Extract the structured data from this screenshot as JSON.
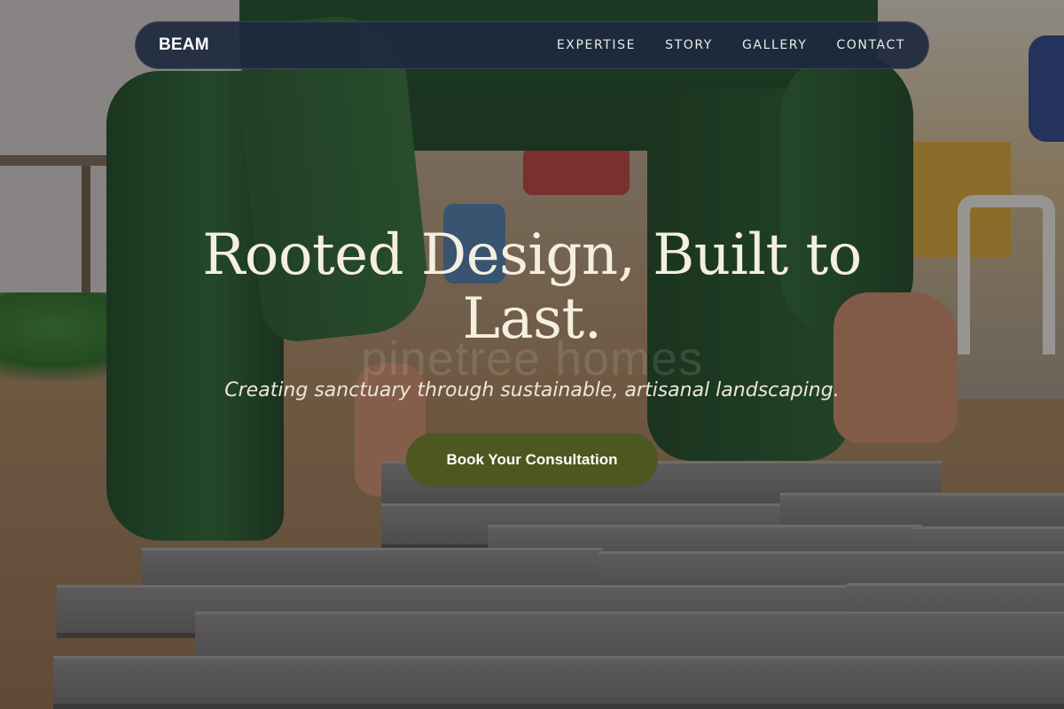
{
  "nav": {
    "brand": "BEAM",
    "links": [
      "EXPERTISE",
      "STORY",
      "GALLERY",
      "CONTACT"
    ]
  },
  "hero": {
    "headline": "Rooted Design, Built to Last.",
    "watermark": "pinetree homes",
    "subtitle": "Creating sanctuary through sustainable, artisanal landscaping.",
    "cta_label": "Book Your Consultation"
  },
  "colors": {
    "nav_background": "#1d293e",
    "cta_background": "#4d5720",
    "headline_text": "#f4efde"
  }
}
